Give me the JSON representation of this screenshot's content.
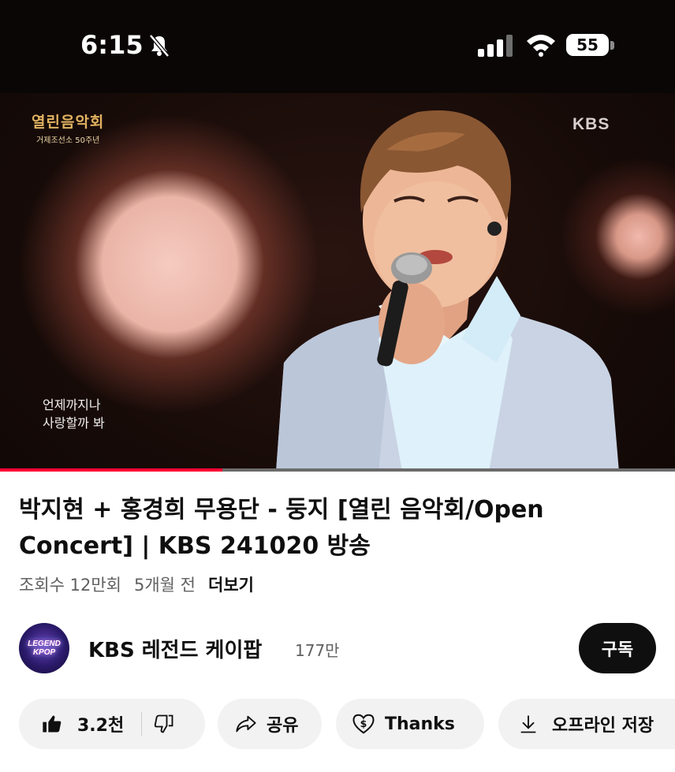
{
  "status_bar": {
    "time": "6:15",
    "battery": "55"
  },
  "video": {
    "show_logo": "열린음악회",
    "show_logo_sub": "거제조선소 50주년",
    "broadcaster_mark": "KBS",
    "lyrics_line1": "언제까지나",
    "lyrics_line2": "사랑할까 봐",
    "progress": 0.33
  },
  "info": {
    "title": "박지현 + 홍경희 무용단 - 둥지 [열린 음악회/Open Concert] | KBS 241020 방송",
    "views": "조회수 12만회",
    "age": "5개월 전",
    "more": "더보기"
  },
  "channel": {
    "avatar_text": "LEGEND KPOP",
    "name": "KBS 레전드 케이팝",
    "subscribers": "177만",
    "subscribe_label": "구독"
  },
  "actions": {
    "likes": "3.2천",
    "share": "공유",
    "thanks": "Thanks",
    "offline_save": "오프라인 저장"
  },
  "icons": [
    "bell-off-icon",
    "signal-icon",
    "wifi-icon",
    "battery-icon",
    "thumbs-up-icon",
    "thumbs-down-icon",
    "share-icon",
    "thanks-icon",
    "download-icon"
  ],
  "colors": {
    "progress": "#ff0033",
    "subscribe_bg": "#0f0f0f",
    "pill_bg": "#f2f2f2",
    "show_logo": "#e2b261"
  }
}
